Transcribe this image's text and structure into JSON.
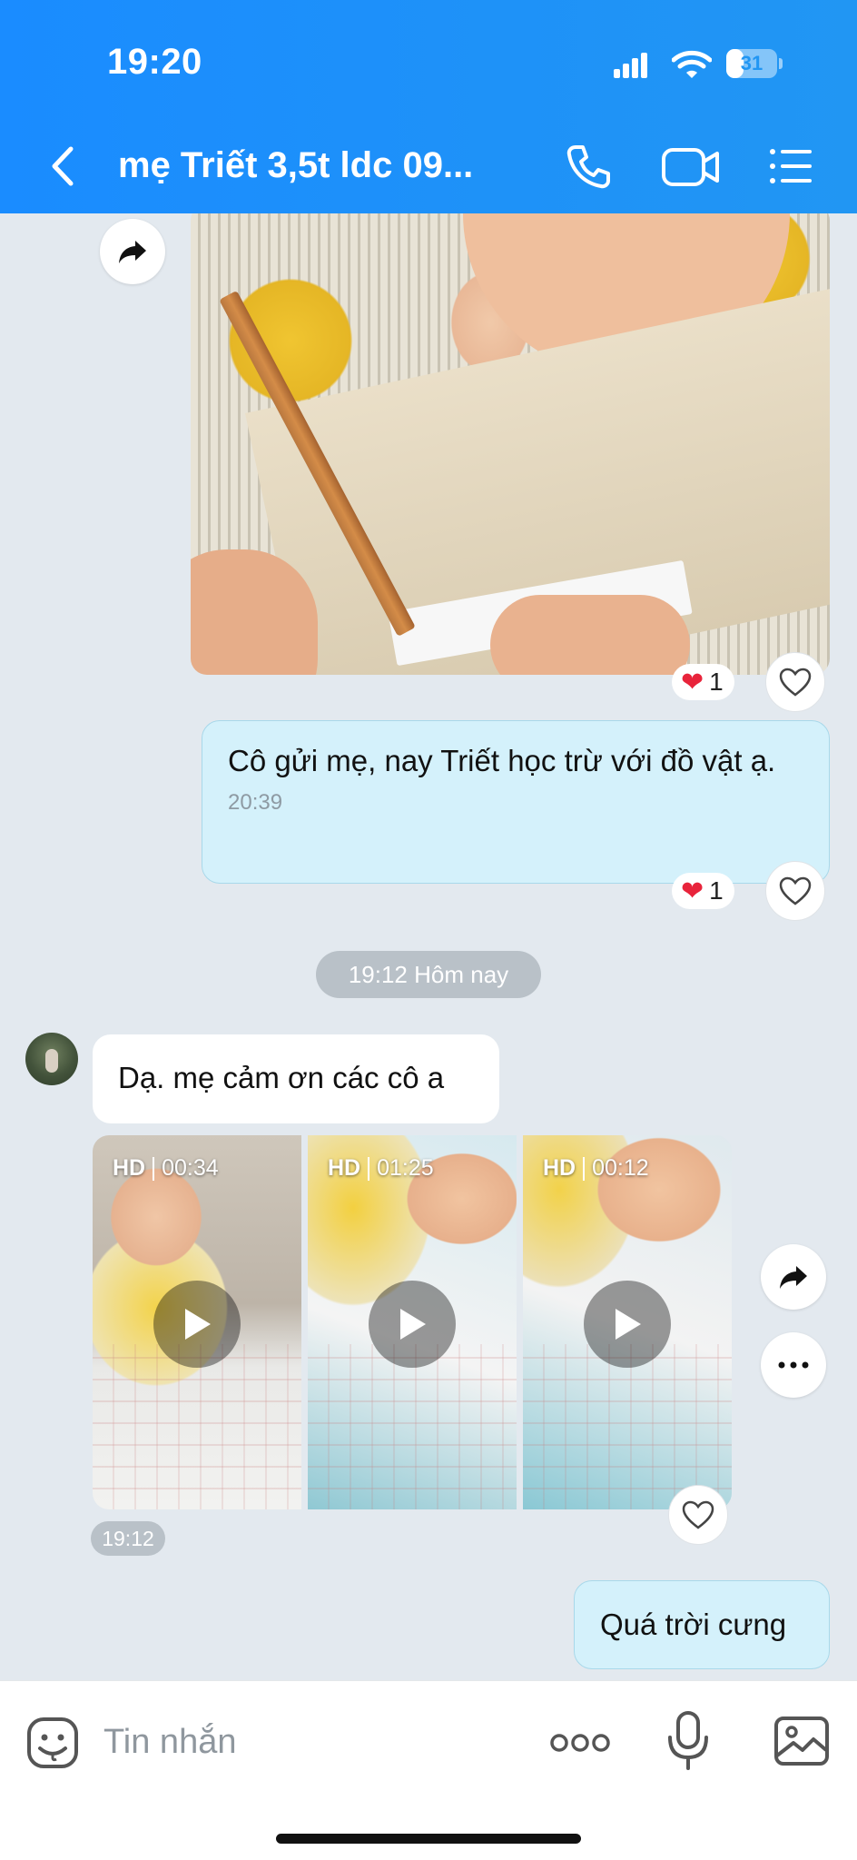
{
  "status_bar": {
    "time": "19:20",
    "battery": "31"
  },
  "header": {
    "title": "mẹ Triết 3,5t ldc 09...",
    "icons": [
      "back-icon",
      "call-icon",
      "video-call-icon",
      "menu-icon"
    ]
  },
  "messages": {
    "photo_reaction": {
      "emoji": "❤️",
      "count": "1"
    },
    "outgoing_1": {
      "text": "Cô gửi mẹ, nay Triết học trừ với đồ vật ạ.",
      "time": "20:39",
      "reaction_emoji": "❤️",
      "reaction_count": "1"
    },
    "date_separator": "19:12 Hôm nay",
    "incoming_1": {
      "text": "Dạ. mẹ cảm ơn các cô a"
    },
    "videos": [
      {
        "quality": "HD",
        "duration": "00:34"
      },
      {
        "quality": "HD",
        "duration": "01:25"
      },
      {
        "quality": "HD",
        "duration": "00:12"
      }
    ],
    "videos_time": "19:12",
    "outgoing_2": {
      "text": "Quá trời cưng"
    }
  },
  "input_bar": {
    "placeholder": "Tin nhắn",
    "icons": [
      "sticker-icon",
      "more-icon",
      "mic-icon",
      "image-icon"
    ]
  },
  "colors": {
    "header": "#1a8cff",
    "chat_background": "#e3e9ef",
    "outgoing_bubble": "#d4f1fb",
    "incoming_bubble": "#ffffff",
    "heart": "#e8243b"
  }
}
